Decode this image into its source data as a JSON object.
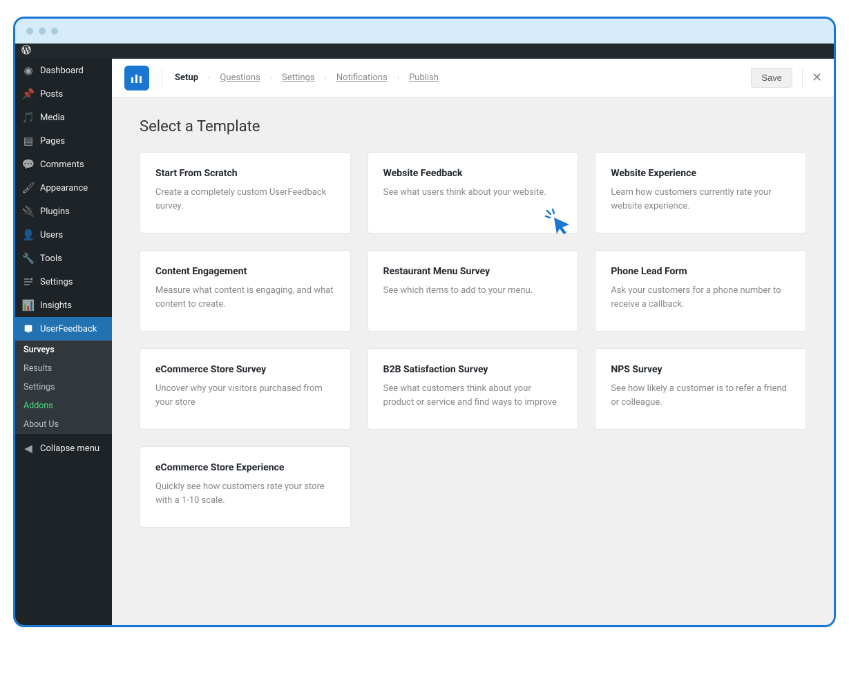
{
  "sidebar": {
    "items": [
      {
        "label": "Dashboard",
        "icon": "dashboard"
      },
      {
        "label": "Posts",
        "icon": "pin"
      },
      {
        "label": "Media",
        "icon": "media"
      },
      {
        "label": "Pages",
        "icon": "pages"
      },
      {
        "label": "Comments",
        "icon": "comments"
      },
      {
        "label": "Appearance",
        "icon": "brush"
      },
      {
        "label": "Plugins",
        "icon": "plug"
      },
      {
        "label": "Users",
        "icon": "users"
      },
      {
        "label": "Tools",
        "icon": "wrench"
      },
      {
        "label": "Settings",
        "icon": "settings"
      },
      {
        "label": "Insights",
        "icon": "insights"
      },
      {
        "label": "UserFeedback",
        "icon": "userfeedback"
      }
    ],
    "submenu": [
      {
        "label": "Surveys"
      },
      {
        "label": "Results"
      },
      {
        "label": "Settings"
      },
      {
        "label": "Addons"
      },
      {
        "label": "About Us"
      }
    ],
    "collapse": "Collapse menu"
  },
  "header": {
    "breadcrumbs": [
      "Setup",
      "Questions",
      "Settings",
      "Notifications",
      "Publish"
    ],
    "save": "Save"
  },
  "page": {
    "title": "Select a Template"
  },
  "templates": [
    {
      "title": "Start From Scratch",
      "desc": "Create a completely custom UserFeedback survey."
    },
    {
      "title": "Website Feedback",
      "desc": "See what users think about your website."
    },
    {
      "title": "Website Experience",
      "desc": "Learn how customers currently rate your website experience."
    },
    {
      "title": "Content Engagement",
      "desc": "Measure what content is engaging, and what content to create."
    },
    {
      "title": "Restaurant Menu Survey",
      "desc": "See which items to add to your menu."
    },
    {
      "title": "Phone Lead Form",
      "desc": "Ask your customers for a phone number to receive a callback."
    },
    {
      "title": "eCommerce Store Survey",
      "desc": "Uncover why your visitors purchased from your store"
    },
    {
      "title": "B2B Satisfaction Survey",
      "desc": "See what customers think about your product or service and find ways to improve"
    },
    {
      "title": "NPS Survey",
      "desc": "See how likely a customer is to refer a friend or colleague."
    },
    {
      "title": "eCommerce Store Experience",
      "desc": "Quickly see how customers rate your store with a 1-10 scale."
    }
  ]
}
